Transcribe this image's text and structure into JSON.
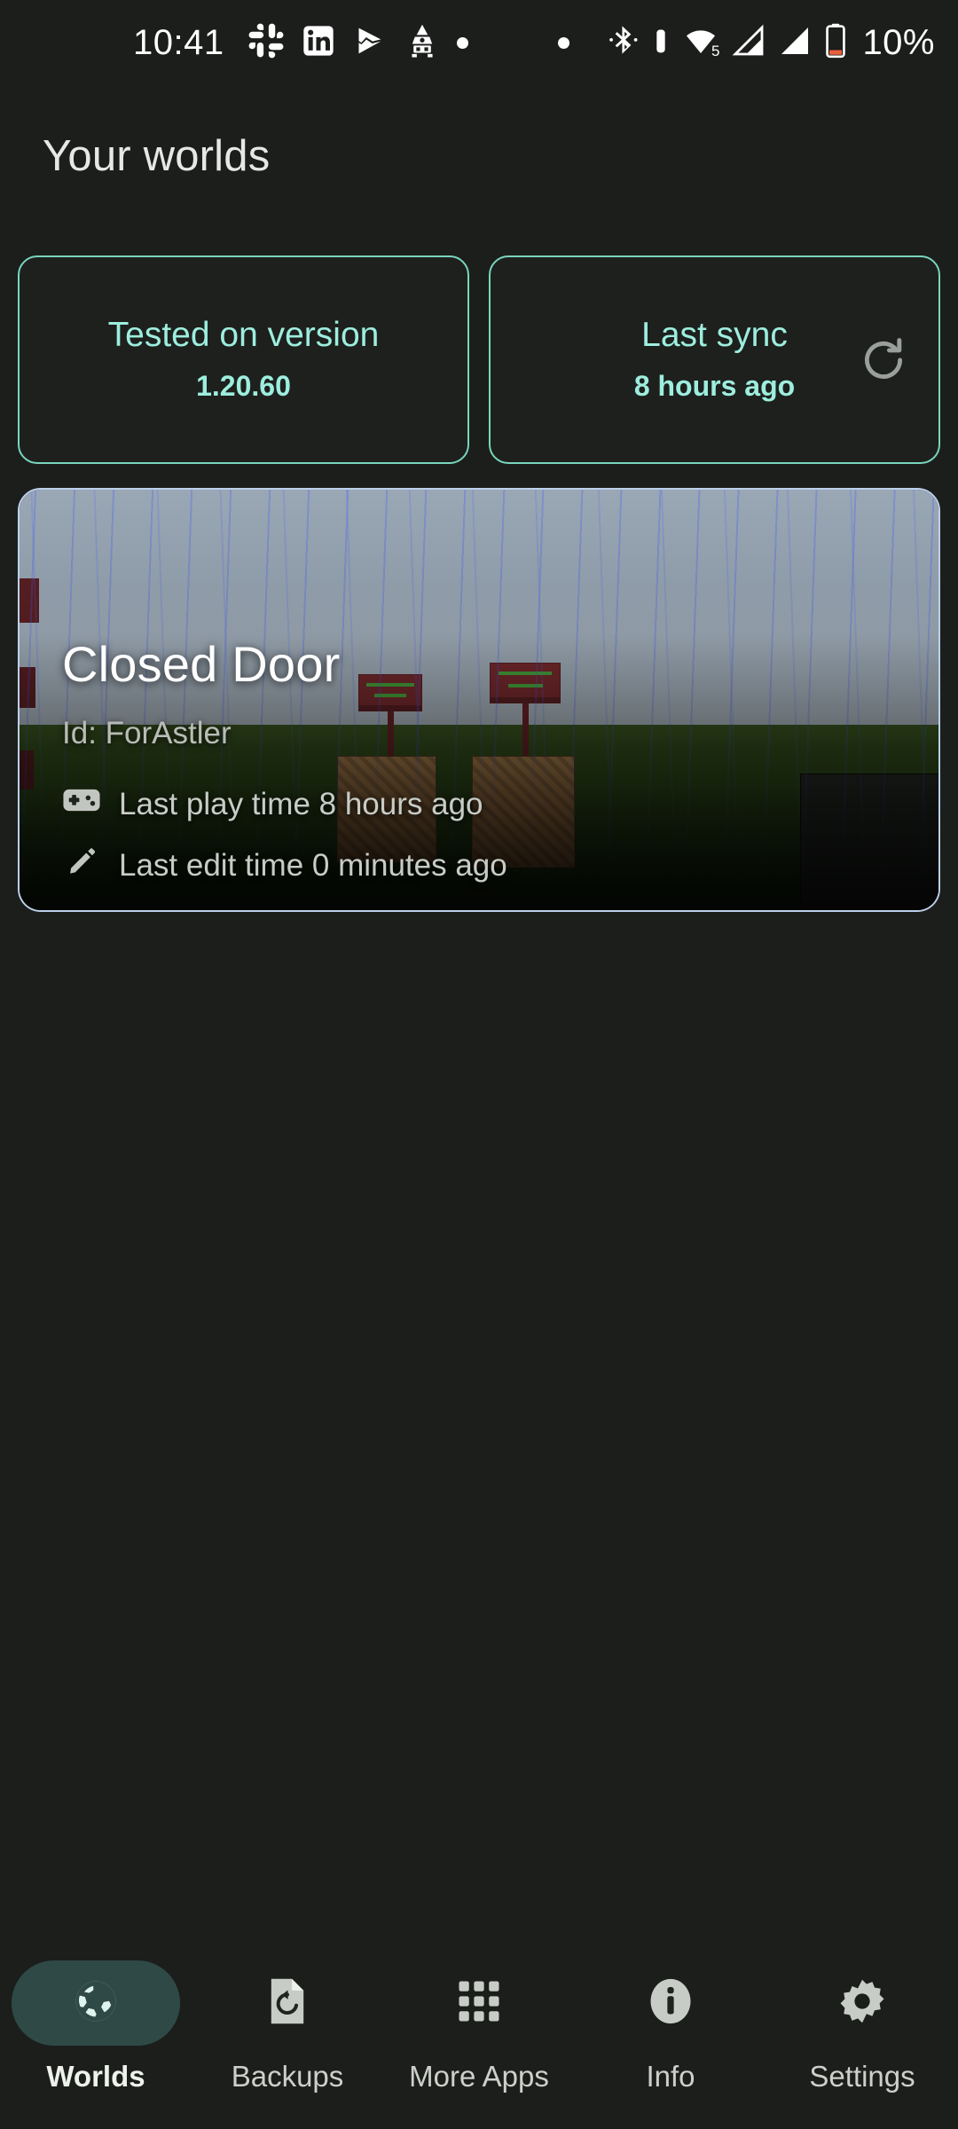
{
  "statusbar": {
    "time": "10:41",
    "battery_percent": "10%",
    "wifi_level": "5",
    "left_icons": [
      "slack-icon",
      "linkedin-icon",
      "play-store-beta-icon",
      "rocket-icon",
      "dot-icon"
    ],
    "right_icons": [
      "dot-icon",
      "bluetooth-icon",
      "vibrate-icon",
      "wifi-icon",
      "signal-sim1-icon",
      "signal-sim2-icon",
      "battery-low-icon"
    ],
    "battery_color": "#e8603c"
  },
  "header": {
    "title": "Your worlds"
  },
  "info_cards": [
    {
      "title": "Tested on version",
      "value": "1.20.60",
      "accent": "#9deede",
      "border": "#79d5bd"
    },
    {
      "title": "Last sync",
      "value": "8 hours ago",
      "accent": "#9deede",
      "border": "#79d5bd",
      "action_icon": "refresh-icon"
    }
  ],
  "world": {
    "name": "Closed Door",
    "id_label": "Id: ForAstler",
    "last_play": "Last play time 8 hours ago",
    "last_edit": "Last edit time 0 minutes ago",
    "play_icon": "gamepad-icon",
    "edit_icon": "pencil-icon",
    "border_color": "#bcd0ea"
  },
  "bottom_nav": {
    "active_color": "#2f4a46",
    "items": [
      {
        "label": "Worlds",
        "icon": "globe-icon",
        "active": true
      },
      {
        "label": "Backups",
        "icon": "restore-file-icon",
        "active": false
      },
      {
        "label": "More Apps",
        "icon": "grid-apps-icon",
        "active": false
      },
      {
        "label": "Info",
        "icon": "info-icon",
        "active": false
      },
      {
        "label": "Settings",
        "icon": "gear-icon",
        "active": false
      }
    ]
  }
}
